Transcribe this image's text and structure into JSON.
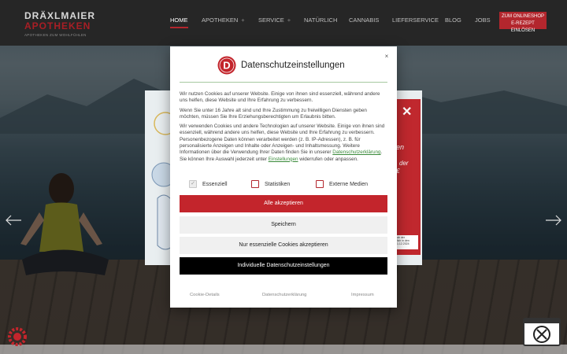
{
  "brand": {
    "line1": "DRÄXLMAIER",
    "line2": "APOTHEKEN",
    "tagline": "APOTHEKEN ZUM WOHLFÜHLEN",
    "accent_color": "#b3262d"
  },
  "nav": {
    "items": [
      {
        "label": "HOME",
        "active": true
      },
      {
        "label": "APOTHEKEN",
        "has_submenu": true
      },
      {
        "label": "SERVICE",
        "has_submenu": true
      },
      {
        "label": "NATÜRLICH"
      },
      {
        "label": "CANNABIS"
      },
      {
        "label": "LIEFERSERVICE"
      },
      {
        "label": "BLOG"
      },
      {
        "label": "JOBS"
      }
    ],
    "submenu_glyph": "+",
    "shop_button": {
      "line1": "ZUM ONLINESHOP",
      "line2": "E-REZEPT EINLÖSEN"
    }
  },
  "promo": {
    "close_glyph": "✕",
    "text1": "en",
    "text2": "der",
    "text3": "€",
    "note": "ab der\nlich in den\n1.12.2024"
  },
  "consent": {
    "logo_letter": "D",
    "title": "Datenschutzeinstellungen",
    "close_glyph": "×",
    "paragraph1": "Wir nutzen Cookies auf unserer Website. Einige von ihnen sind essenziell, während andere uns helfen, diese Website und Ihre Erfahrung zu verbessern.",
    "paragraph2": "Wenn Sie unter 16 Jahre alt sind und Ihre Zustimmung zu freiwilligen Diensten geben möchten, müssen Sie Ihre Erziehungsberechtigten um Erlaubnis bitten.",
    "paragraph3_start": "Wir verwenden Cookies und andere Technologien auf unserer Website. Einige von ihnen sind essenziell, während andere uns helfen, diese Website und Ihre Erfahrung zu verbessern. Personenbezogene Daten können verarbeitet werden (z. B. IP-Adressen), z. B. für personalisierte Anzeigen und Inhalte oder Anzeigen- und Inhaltsmessung. Weitere Informationen über die Verwendung Ihrer Daten finden Sie in unserer ",
    "paragraph3_link1": "Datenschutzerklärung",
    "paragraph3_mid": ". Sie können Ihre Auswahl jederzeit unter ",
    "paragraph3_link2": "Einstellungen",
    "paragraph3_end": " widerrufen oder anpassen.",
    "checkboxes": [
      {
        "label": "Essenziell",
        "checked": true,
        "disabled": true
      },
      {
        "label": "Statistiken",
        "checked": false
      },
      {
        "label": "Externe Medien",
        "checked": false
      }
    ],
    "check_glyph": "✓",
    "buttons": {
      "accept_all": "Alle akzeptieren",
      "save": "Speichern",
      "essential_only": "Nur essenzielle Cookies akzeptieren",
      "individual": "Individuelle Datenschutzeinstellungen"
    },
    "footer": {
      "cookie_details": "Cookie-Details",
      "privacy": "Datenschutzerklärung",
      "imprint": "Impressum"
    }
  }
}
